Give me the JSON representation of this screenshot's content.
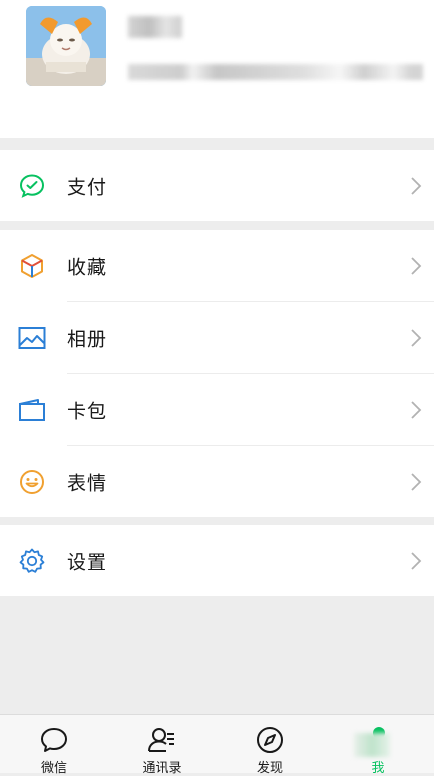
{
  "profile": {
    "avatar_label": "avatar"
  },
  "menu": {
    "pay": {
      "label": "支付",
      "icon": "pay-icon",
      "color": "#07c160"
    },
    "favorites": {
      "label": "收藏",
      "icon": "cube-icon",
      "color": "#f0a030"
    },
    "album": {
      "label": "相册",
      "icon": "picture-icon",
      "color": "#2b7fd6"
    },
    "cards": {
      "label": "卡包",
      "icon": "wallet-icon",
      "color": "#2b7fd6"
    },
    "stickers": {
      "label": "表情",
      "icon": "smile-icon",
      "color": "#f0a030"
    },
    "settings": {
      "label": "设置",
      "icon": "gear-icon",
      "color": "#2b7fd6"
    }
  },
  "tabbar": {
    "tabs": [
      {
        "label": "微信",
        "icon": "chat-bubble-icon"
      },
      {
        "label": "通讯录",
        "icon": "contacts-icon"
      },
      {
        "label": "发现",
        "icon": "compass-icon"
      },
      {
        "label": "我",
        "icon": "me-icon",
        "active": true
      }
    ],
    "accent": "#07c160"
  }
}
